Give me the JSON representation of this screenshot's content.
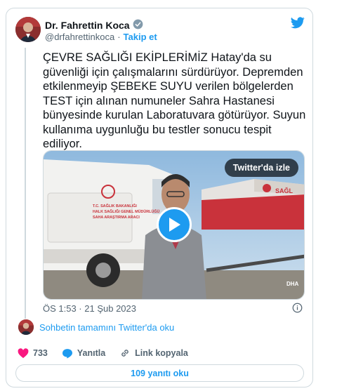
{
  "author": {
    "name": "Dr. Fahrettin Koca",
    "handle": "@drfahrettinkoca",
    "separator": "·",
    "follow_label": "Takip et"
  },
  "tweet": {
    "text": "ÇEVRE SAĞLIĞI EKİPLERİMİZ Hatay'da su güvenliği için çalışmalarını sürdürüyor. Depremden etkilenmeyip ŞEBEKE SUYU verilen bölgelerden TEST için alınan numuneler Sahra Hastanesi bünyesinde kurulan Laboratuvara götürüyor. Suyun kullanıma uygunluğu bu testler sonucu tespit ediliyor."
  },
  "media": {
    "watch_label": "Twitter'da izle",
    "van_text": [
      "T.C. SAĞLIK BAKANLIĞI",
      "HALK SAĞLIĞI GENEL MÜDÜRLÜĞÜ",
      "SAHA ARAŞTIRMA ARACI"
    ],
    "tent_text": "SAĞL",
    "watermark": "DHA"
  },
  "meta": {
    "timestamp": "ÖS 1:53 · 21 Şub 2023"
  },
  "conversation": {
    "link_label": "Sohbetin tamamını Twitter'da oku"
  },
  "actions": {
    "like_count": "733",
    "reply_label": "Yanıtla",
    "copy_link_label": "Link kopyala"
  },
  "replies_button": {
    "label": "109 yanıtı oku"
  },
  "colors": {
    "accent": "#1d9bf0",
    "like": "#f91880",
    "text": "#0f1419",
    "secondary": "#536471",
    "border": "#cfd9de"
  },
  "icons": [
    "verified-badge-icon",
    "twitter-bird-icon",
    "play-icon",
    "info-icon",
    "heart-icon",
    "reply-icon",
    "link-icon"
  ]
}
